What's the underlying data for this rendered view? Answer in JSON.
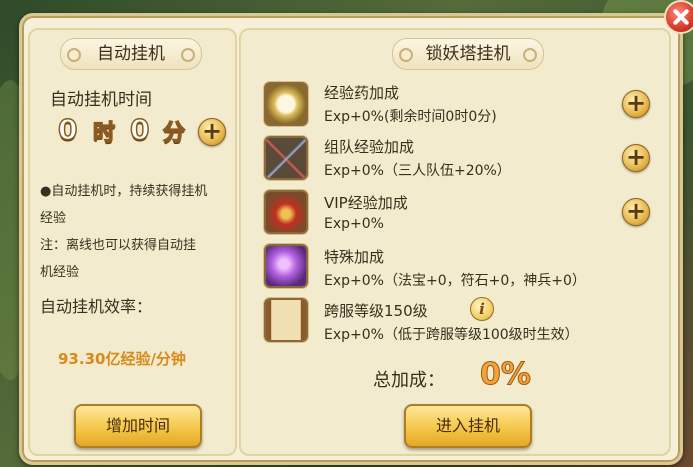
{
  "window": {
    "close_icon": "close-icon"
  },
  "left": {
    "title": "自动挂机",
    "time_label": "自动挂机时间",
    "hours": "0",
    "hours_unit": "时",
    "minutes": "0",
    "minutes_unit": "分",
    "desc1_line1": "●自动挂机时，持续获得挂机",
    "desc1_line2": "经验",
    "desc2_line1": "注：离线也可以获得自动挂",
    "desc2_line2": "机经验",
    "efficiency_label": "自动挂机效率：",
    "efficiency_value": "93.30亿经验/分钟",
    "add_time_button": "增加时间"
  },
  "right": {
    "title": "锁妖塔挂机",
    "bonuses": [
      {
        "name": "经验药加成",
        "detail": "Exp+0%(剩余时间0时0分)",
        "icon": "mirror-medal-icon"
      },
      {
        "name": "组队经验加成",
        "detail": "Exp+0%（三人队伍+20%）",
        "icon": "crossed-swords-icon"
      },
      {
        "name": "VIP经验加成",
        "detail": "Exp+0%",
        "icon": "treasure-chest-icon"
      },
      {
        "name": "特殊加成",
        "detail": "Exp+0%（法宝+0，符石+0，神兵+0）",
        "icon": "purple-crystal-icon"
      },
      {
        "name": "跨服等级150级",
        "detail": "Exp+0%（低于跨服等级100级时生效）",
        "icon": "scroll-icon"
      }
    ],
    "total_label": "总加成：",
    "total_value": "0%",
    "enter_button": "进入挂机"
  },
  "colors": {
    "accent": "#d98a1a",
    "panel": "#f6f0d8",
    "button": "#f3c443"
  }
}
